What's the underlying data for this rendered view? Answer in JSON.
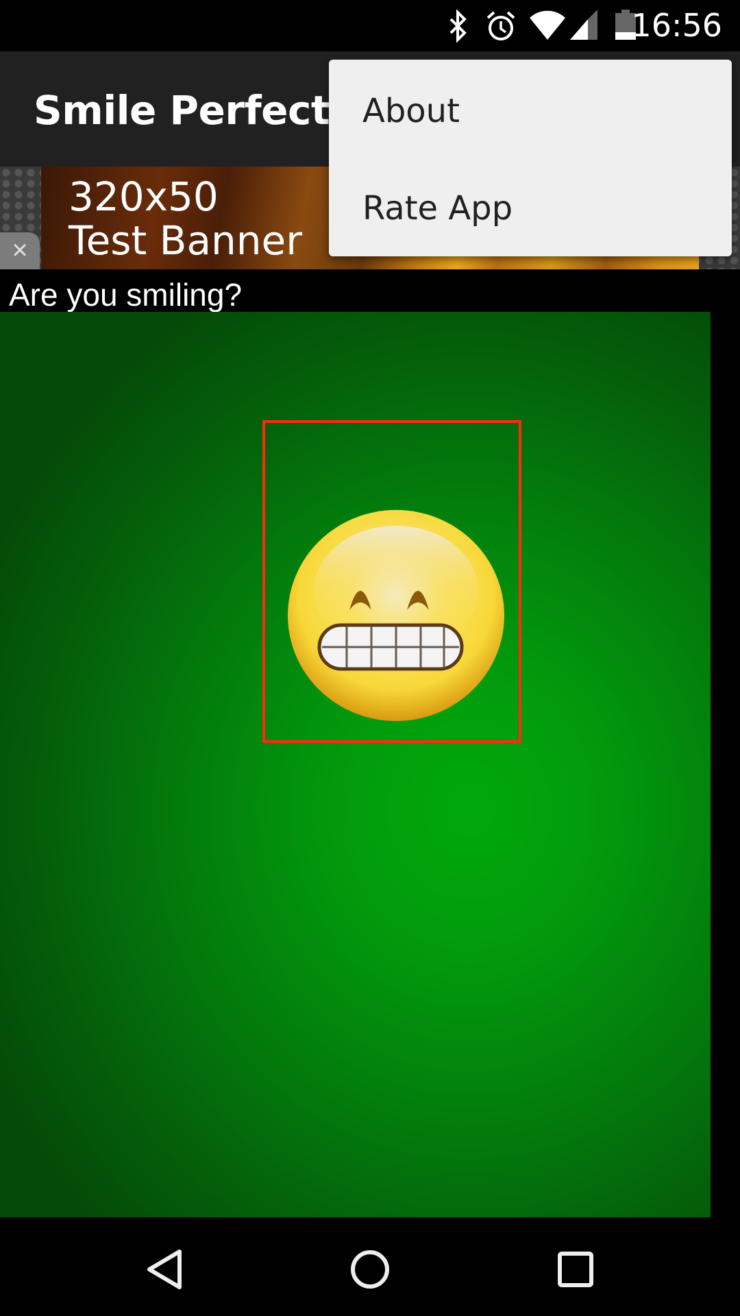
{
  "status_bar": {
    "time": "16:56",
    "icons": [
      "bluetooth-icon",
      "alarm-icon",
      "wifi-icon",
      "cell-signal-icon",
      "battery-icon"
    ]
  },
  "app_bar": {
    "title": "Smile Perfect"
  },
  "ad_banner": {
    "line1": "320x50",
    "line2": "Test Banner",
    "close_label": "×"
  },
  "overflow_menu": {
    "items": [
      {
        "label": "About"
      },
      {
        "label": "Rate App"
      }
    ]
  },
  "main": {
    "prompt": "Are you smiling?",
    "face_box_color": "#ff2a10",
    "background_color": "#00a80c"
  },
  "nav_bar": {
    "buttons": [
      "back",
      "home",
      "recents"
    ]
  }
}
